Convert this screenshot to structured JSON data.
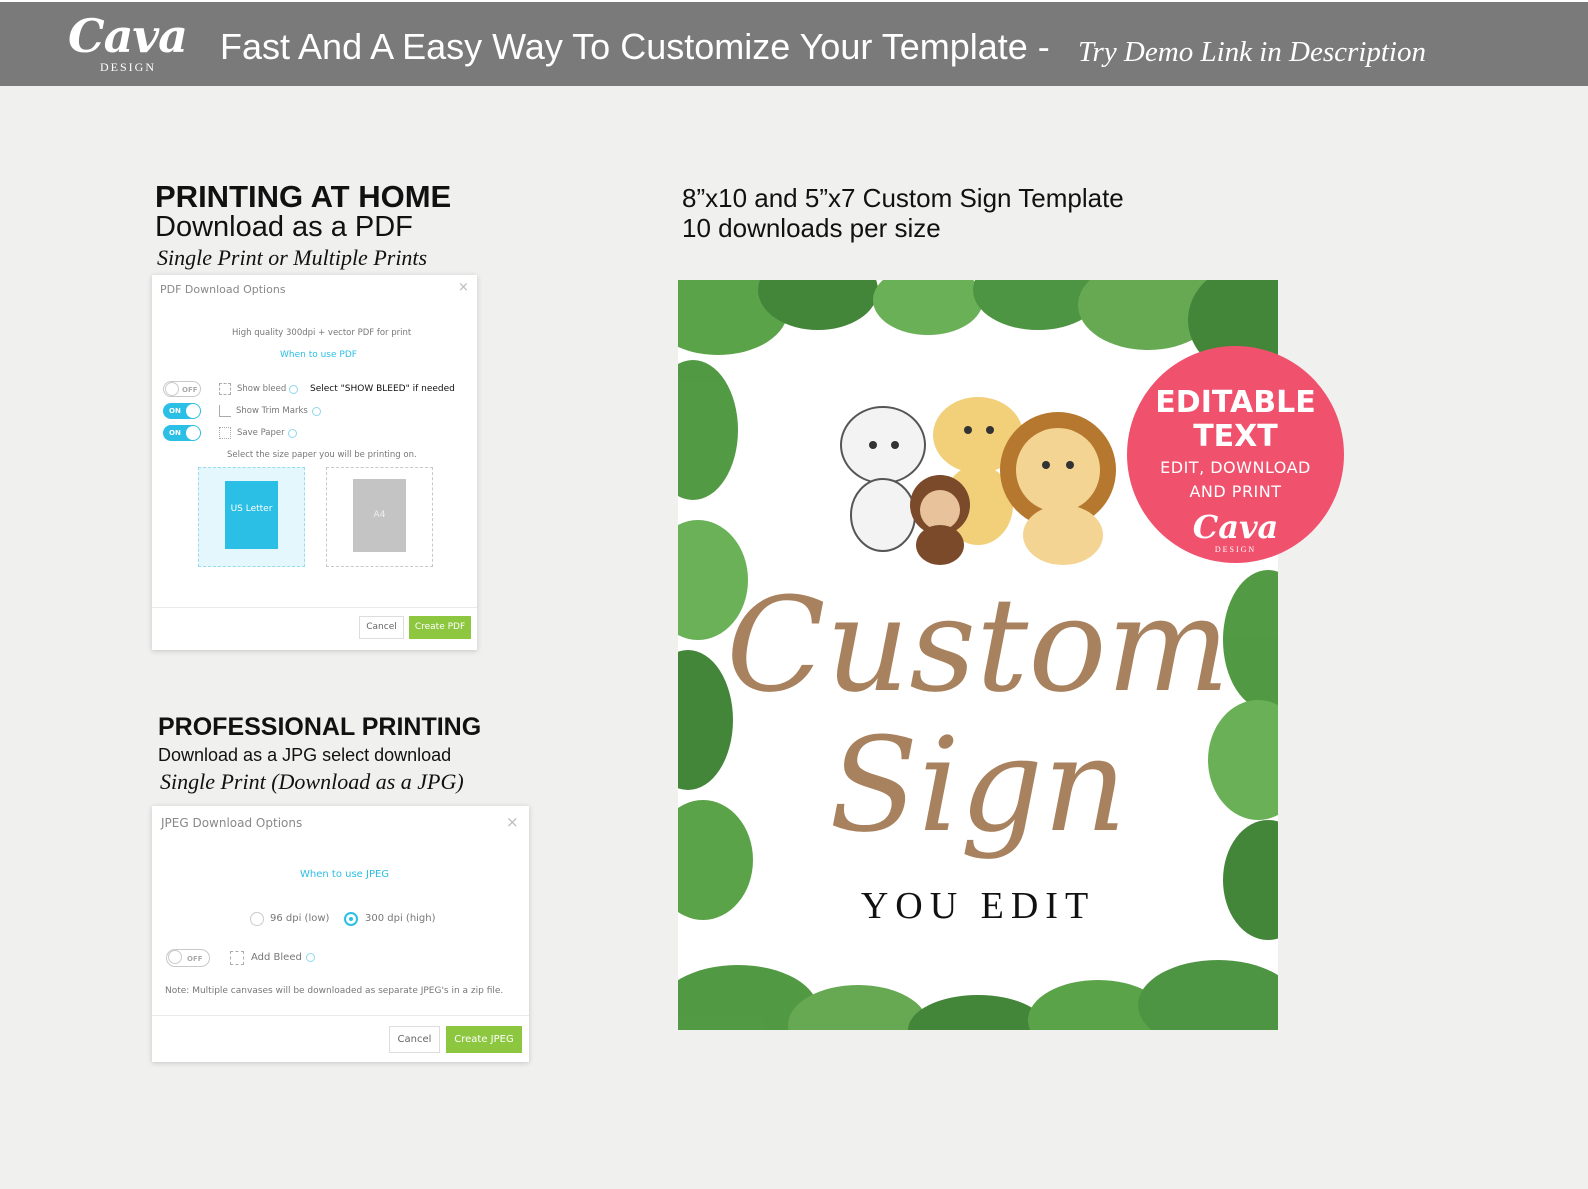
{
  "header": {
    "logo": "Cava",
    "logo_sub": "DESIGN",
    "title": "Fast And A Easy Way To Customize Your Template -",
    "subtitle": "Try Demo Link in Description"
  },
  "home_section": {
    "heading": "PRINTING AT HOME",
    "subheading": "Download as a PDF",
    "note": "Single Print or Multiple Prints"
  },
  "pdf_dialog": {
    "title": "PDF Download Options",
    "close": "×",
    "quality_text": "High quality 300dpi + vector PDF for print",
    "link": "When to use PDF",
    "options": [
      {
        "toggle": "OFF",
        "label": "Show bleed",
        "state": "off"
      },
      {
        "toggle": "ON",
        "label": "Show Trim Marks",
        "state": "on"
      },
      {
        "toggle": "ON",
        "label": "Save Paper",
        "state": "on"
      }
    ],
    "hint": "Select \"SHOW BLEED\" if needed",
    "paper_prompt": "Select the size paper you will be printing on.",
    "paper_letter": "US Letter",
    "paper_a4": "A4",
    "cancel": "Cancel",
    "create": "Create PDF"
  },
  "pro_section": {
    "heading": "PROFESSIONAL PRINTING",
    "subheading": "Download as a JPG select download",
    "note": "Single Print (Download as a JPG)"
  },
  "jpeg_dialog": {
    "title": "JPEG Download Options",
    "close": "×",
    "link": "When to use JPEG",
    "radio_low": "96 dpi (low)",
    "radio_high": "300 dpi (high)",
    "selected": "300 dpi (high)",
    "toggle": "OFF",
    "bleed_label": "Add Bleed",
    "note": "Note: Multiple canvases will be downloaded as separate JPEG's in a zip file.",
    "cancel": "Cancel",
    "create": "Create JPEG"
  },
  "right": {
    "line1": "8”x10 and 5”x7 Custom Sign Template",
    "line2": "10 downloads per size"
  },
  "sign": {
    "title_line1": "Custom",
    "title_line2": "Sign",
    "subtitle": "YOU EDIT"
  },
  "badge": {
    "line1": "EDITABLE",
    "line2": "TEXT",
    "line3": "EDIT, DOWNLOAD",
    "line4": "AND PRINT",
    "logo": "Cava",
    "logo_sub": "DESIGN"
  },
  "colors": {
    "header_bg": "#7a7a7a",
    "accent_blue": "#2bbfe6",
    "accent_green": "#8dc63f",
    "badge_pink": "#f0526e",
    "sign_brown": "#a8825e",
    "leaf_green": "#3f8f2f"
  }
}
